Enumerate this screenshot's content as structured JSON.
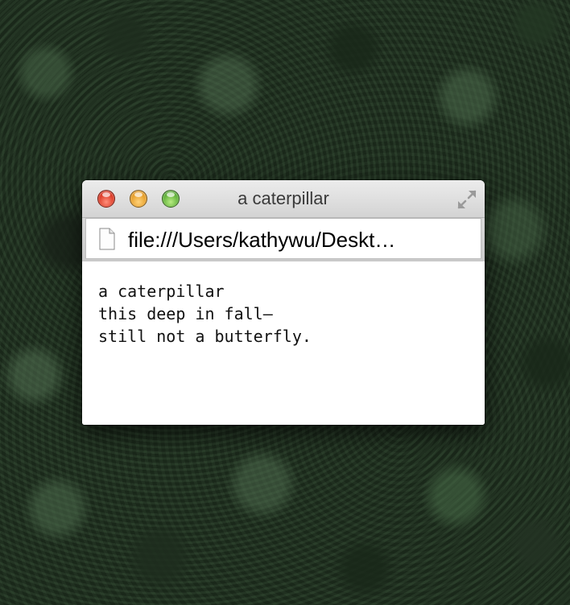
{
  "window": {
    "title": "a caterpillar"
  },
  "addressbar": {
    "url": "file:///Users/kathywu/Deskt…"
  },
  "content": {
    "lines": [
      "a caterpillar",
      "this deep in fall—",
      "still not a butterfly."
    ]
  },
  "icons": {
    "close": "close-button",
    "minimize": "minimize-button",
    "zoom": "zoom-button",
    "fullscreen": "fullscreen-icon",
    "page": "document-icon"
  },
  "colors": {
    "close": "#d52b17",
    "minimize": "#e2951a",
    "zoom": "#4fa52a"
  }
}
